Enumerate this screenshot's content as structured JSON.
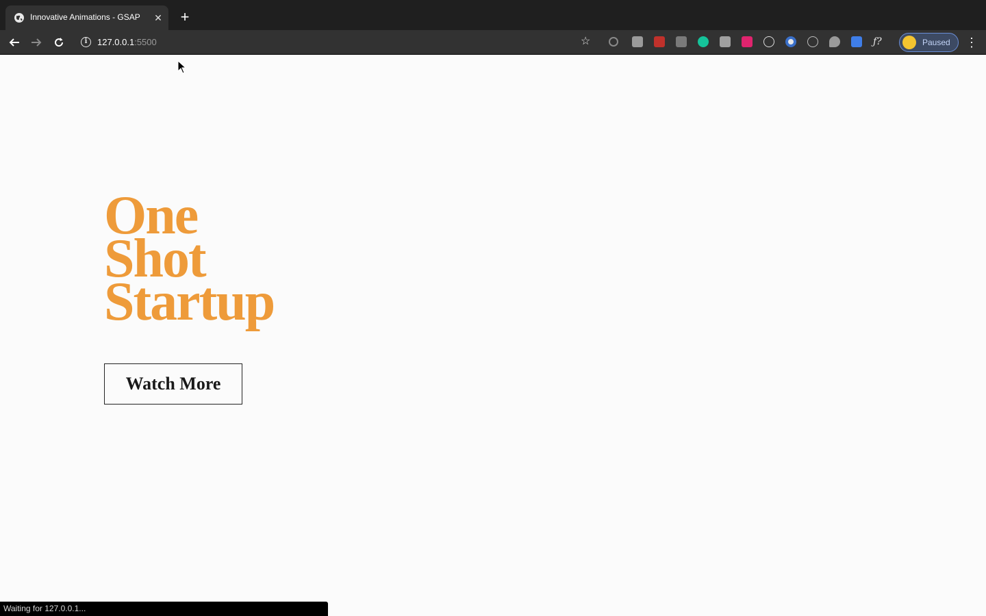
{
  "browser": {
    "tab": {
      "title": "Innovative Animations - GSAP",
      "close_glyph": "✕",
      "new_tab_glyph": "+"
    },
    "address": {
      "host": "127.0.0.1",
      "port": ":5500"
    },
    "profile": {
      "label": "Paused"
    },
    "extensions": [
      "refresh-ext-icon",
      "bookmark-ext-icon",
      "chart-ext-icon",
      "css-ext-icon",
      "grammarly-ext-icon",
      "home-ext-icon",
      "timer-ext-icon",
      "react-ext-icon",
      "circle-ext-icon",
      "clock-ext-icon",
      "leaf-ext-icon",
      "translate-ext-icon",
      "font-ext-icon"
    ]
  },
  "page": {
    "hero": {
      "line1": "One",
      "line2": "Shot",
      "line3": "Startup"
    },
    "cta_label": "Watch More"
  },
  "status": {
    "text": "Waiting for 127.0.0.1..."
  },
  "colors": {
    "accent": "#ee9b3a",
    "page_bg": "#fbfbfb",
    "chrome_bg": "#323232"
  }
}
